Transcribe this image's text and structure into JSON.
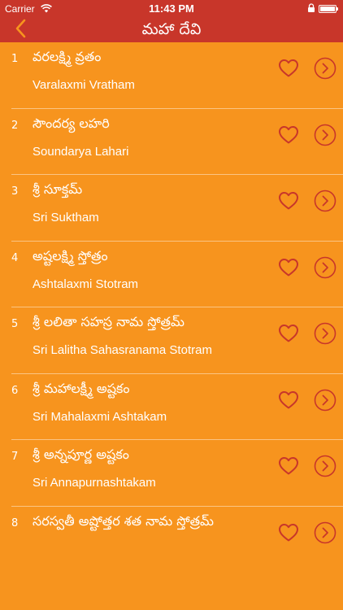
{
  "status_bar": {
    "carrier": "Carrier",
    "time": "11:43 PM"
  },
  "nav": {
    "title": "మహా దేవి",
    "back_icon": "chevron-left-icon"
  },
  "colors": {
    "background": "#F7941E",
    "header": "#C8362A",
    "icon": "#C8362A",
    "text": "#FFFFFF"
  },
  "items": [
    {
      "num": "1",
      "title_te": "వరలక్ష్మి వ్రతం",
      "title_en": "Varalaxmi Vratham"
    },
    {
      "num": "2",
      "title_te": "సౌందర్య లహరి",
      "title_en": "Soundarya Lahari"
    },
    {
      "num": "3",
      "title_te": "శ్రీ సూక్తమ్",
      "title_en": "Sri Suktham"
    },
    {
      "num": "4",
      "title_te": "అష్టలక్ష్మి స్తోత్రం",
      "title_en": "Ashtalaxmi Stotram"
    },
    {
      "num": "5",
      "title_te": "శ్రీ లలితా సహస్ర నామ స్తోత్రమ్",
      "title_en": "Sri Lalitha Sahasranama Stotram"
    },
    {
      "num": "6",
      "title_te": "శ్రీ మహాలక్ష్మీ అష్టకం",
      "title_en": "Sri Mahalaxmi Ashtakam"
    },
    {
      "num": "7",
      "title_te": "శ్రీ అన్నపూర్ణ అష్టకం",
      "title_en": "Sri Annapurnashtakam"
    },
    {
      "num": "8",
      "title_te": "సరస్వతీ అష్టోత్తర శత నామ స్తోత్రమ్",
      "title_en": ""
    }
  ],
  "row_icons": {
    "favorite": "heart-outline-icon",
    "open": "chevron-right-circle-icon"
  }
}
